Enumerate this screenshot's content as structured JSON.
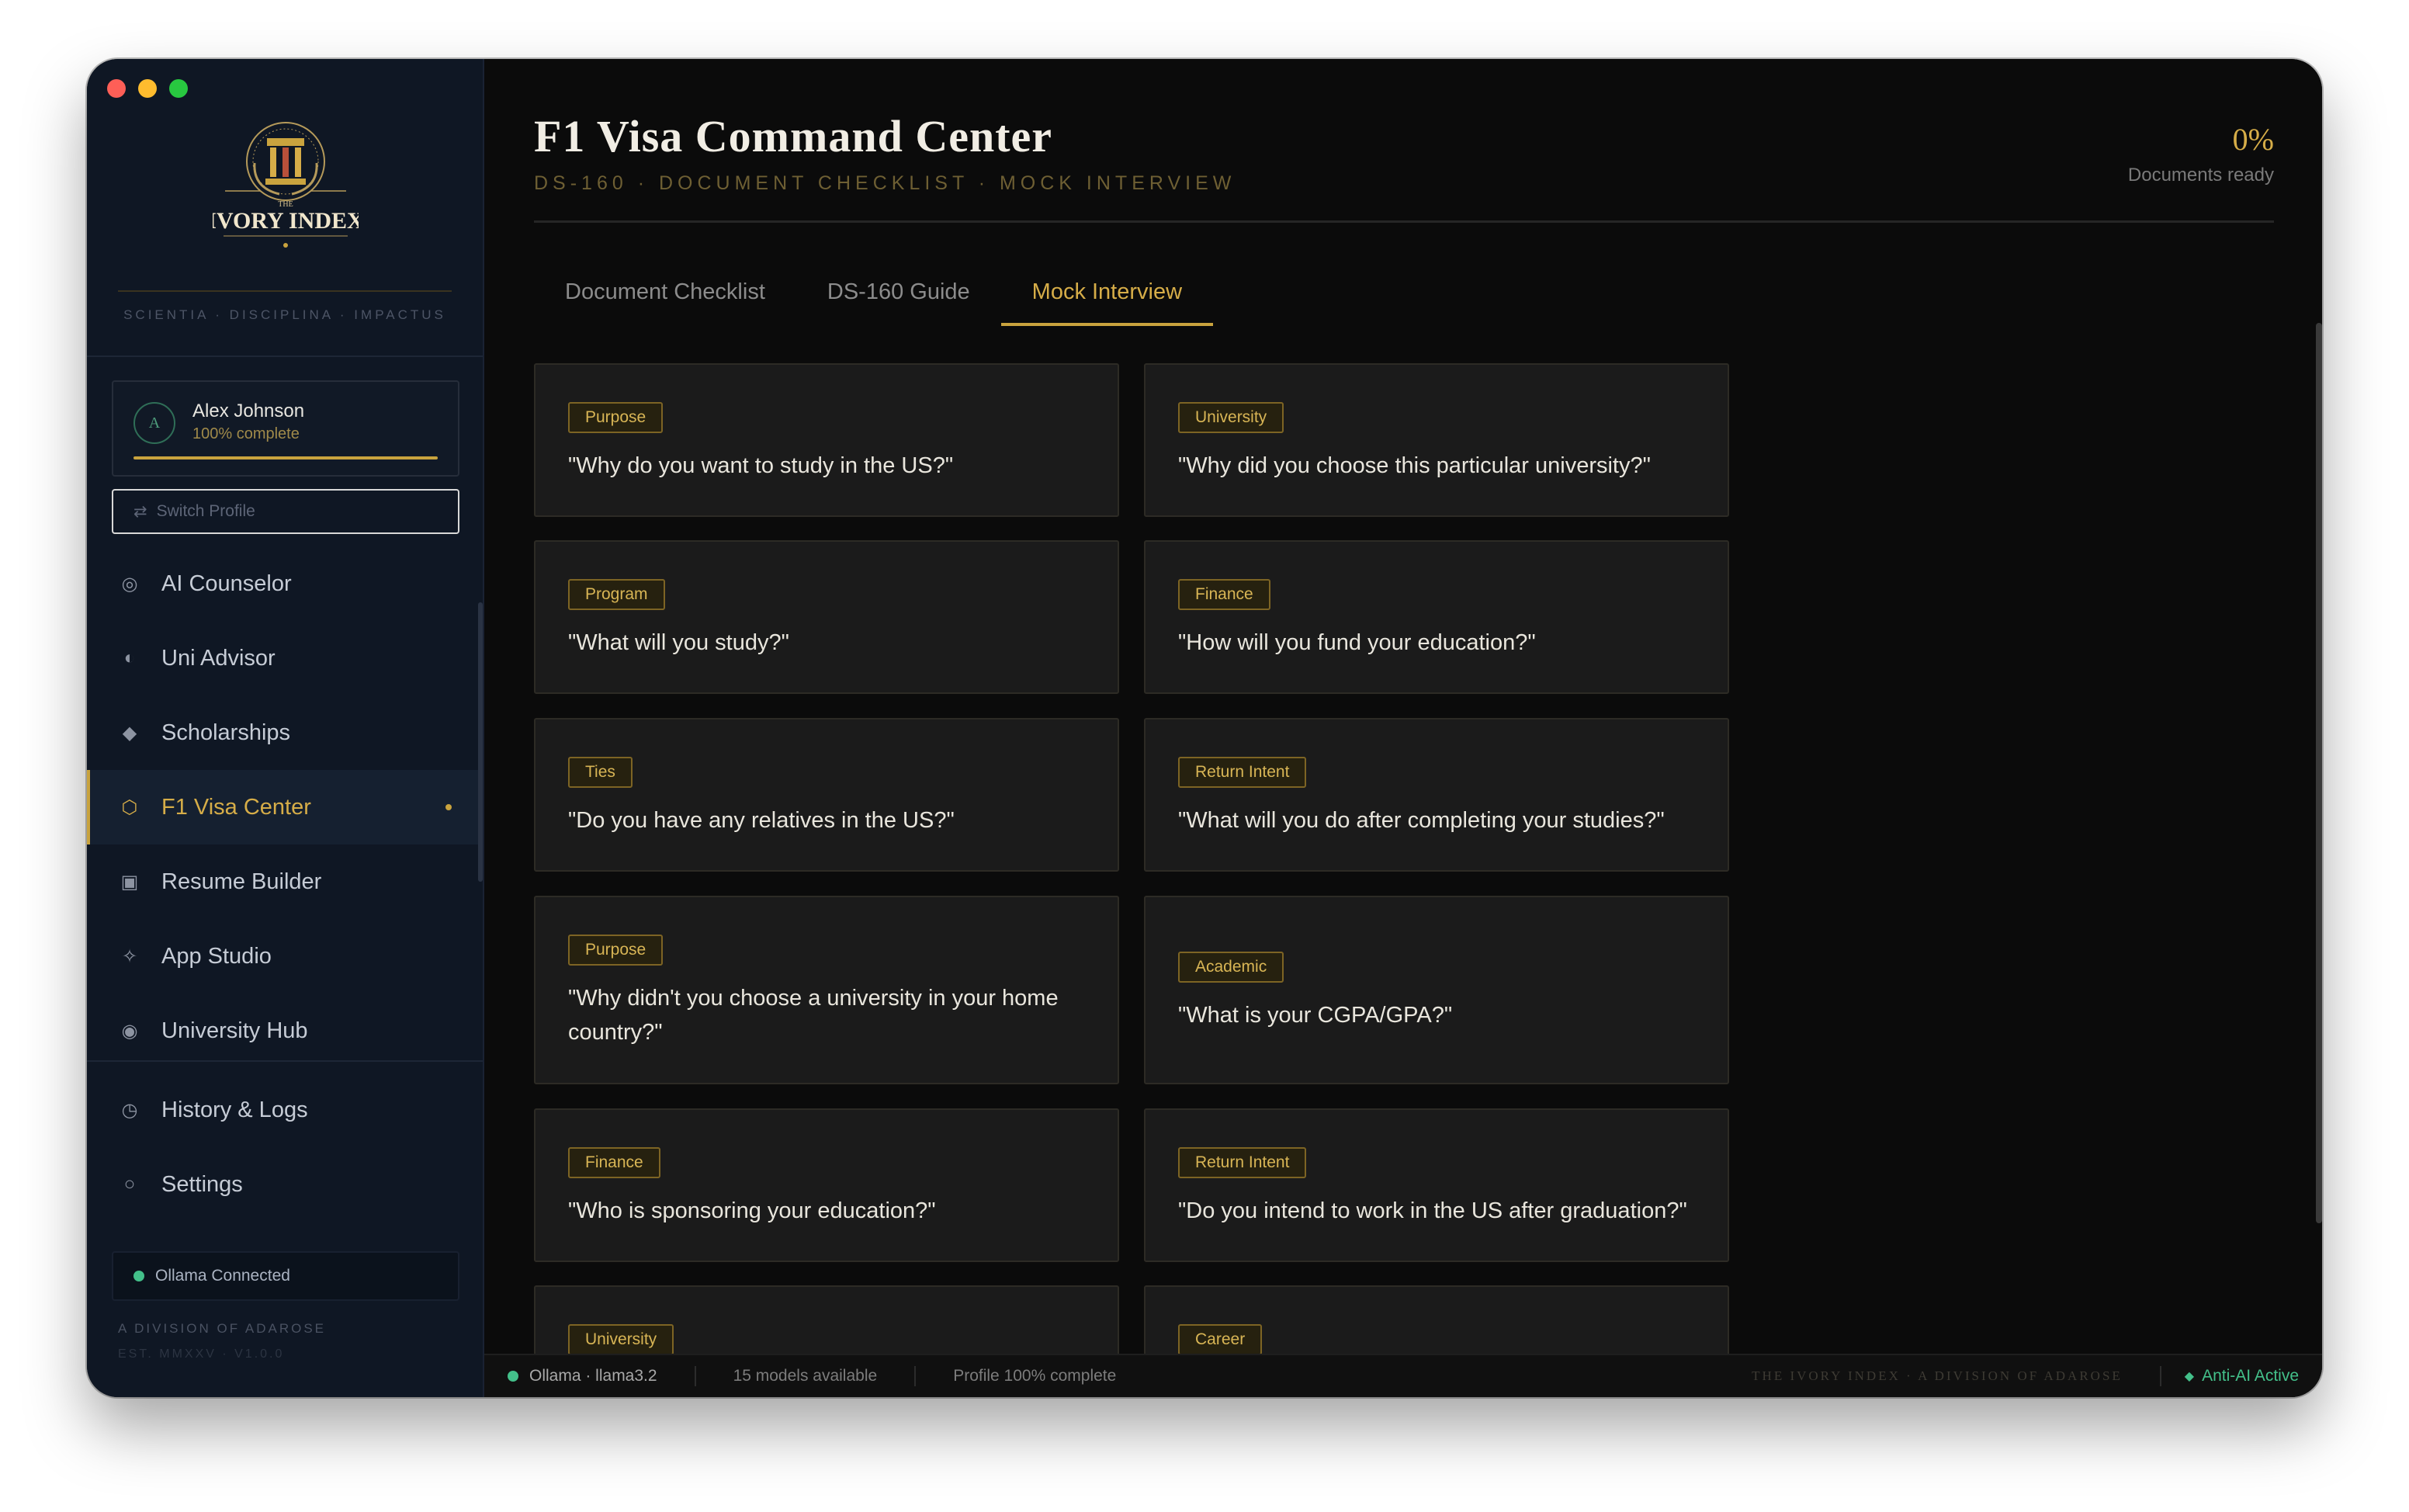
{
  "window": {
    "traffic_colors": [
      "#fe5f57",
      "#febc2e",
      "#28c840"
    ]
  },
  "brand": {
    "logo_text": "IVORY INDEX",
    "logo_small": "THE",
    "motto": "SCIENTIA · DISCIPLINA · IMPACTUS",
    "division": "A DIVISION OF ADAROSE",
    "est": "EST. MMXXV · V1.0.0"
  },
  "profile": {
    "initial": "A",
    "name": "Alex Johnson",
    "progress_label": "100% complete",
    "progress_fraction": 1.0,
    "switch_label": "Switch Profile",
    "switch_icon": "⇄"
  },
  "nav": {
    "items": [
      {
        "label": "AI Counselor",
        "icon": "ring-icon",
        "glyph": "◎",
        "active": false
      },
      {
        "label": "Uni Advisor",
        "icon": "half-circle-icon",
        "glyph": "◐",
        "active": false
      },
      {
        "label": "Scholarships",
        "icon": "diamond-icon",
        "glyph": "◆",
        "active": false
      },
      {
        "label": "F1 Visa Center",
        "icon": "hexagon-icon",
        "glyph": "⬡",
        "active": true
      },
      {
        "label": "Resume Builder",
        "icon": "square-icon",
        "glyph": "▣",
        "active": false
      },
      {
        "label": "App Studio",
        "icon": "sparkle-icon",
        "glyph": "✧",
        "active": false
      },
      {
        "label": "University Hub",
        "icon": "dot-circle-icon",
        "glyph": "◉",
        "active": false
      }
    ],
    "secondary": [
      {
        "label": "History & Logs",
        "icon": "clock-icon",
        "glyph": "◷"
      },
      {
        "label": "Settings",
        "icon": "circle-icon",
        "glyph": "○"
      }
    ]
  },
  "ollama": {
    "label": "Ollama Connected"
  },
  "header": {
    "title": "F1 Visa Command Center",
    "subtitle": "DS-160 · DOCUMENT CHECKLIST · MOCK INTERVIEW",
    "percent": "0%",
    "percent_label": "Documents ready"
  },
  "tabs": [
    {
      "label": "Document Checklist",
      "active": false
    },
    {
      "label": "DS-160 Guide",
      "active": false
    },
    {
      "label": "Mock Interview",
      "active": true
    }
  ],
  "cards": [
    {
      "tag": "Purpose",
      "question": "\"Why do you want to study in the US?\""
    },
    {
      "tag": "University",
      "question": "\"Why did you choose this particular university?\""
    },
    {
      "tag": "Program",
      "question": "\"What will you study?\""
    },
    {
      "tag": "Finance",
      "question": "\"How will you fund your education?\""
    },
    {
      "tag": "Ties",
      "question": "\"Do you have any relatives in the US?\""
    },
    {
      "tag": "Return Intent",
      "question": "\"What will you do after completing your studies?\""
    },
    {
      "tag": "Purpose",
      "question": "\"Why didn't you choose a university in your home country?\""
    },
    {
      "tag": "Academic",
      "question": "\"What is your CGPA/GPA?\""
    },
    {
      "tag": "Finance",
      "question": "\"Who is sponsoring your education?\""
    },
    {
      "tag": "Return Intent",
      "question": "\"Do you intend to work in the US after graduation?\""
    },
    {
      "tag": "University",
      "question": ""
    },
    {
      "tag": "Career",
      "question": ""
    }
  ],
  "statusbar": {
    "model": "Ollama · llama3.2",
    "models": "15 models available",
    "profile": "Profile 100% complete",
    "brand": "THE IVORY INDEX · A DIVISION OF ADAROSE",
    "anti_ai": "Anti-AI Active",
    "anti_ai_glyph": "◆"
  },
  "colors": {
    "accent": "#c9a33e",
    "status_green": "#43c08a",
    "sidebar_bg": "#0f1724",
    "main_bg": "#0b0b0b"
  }
}
